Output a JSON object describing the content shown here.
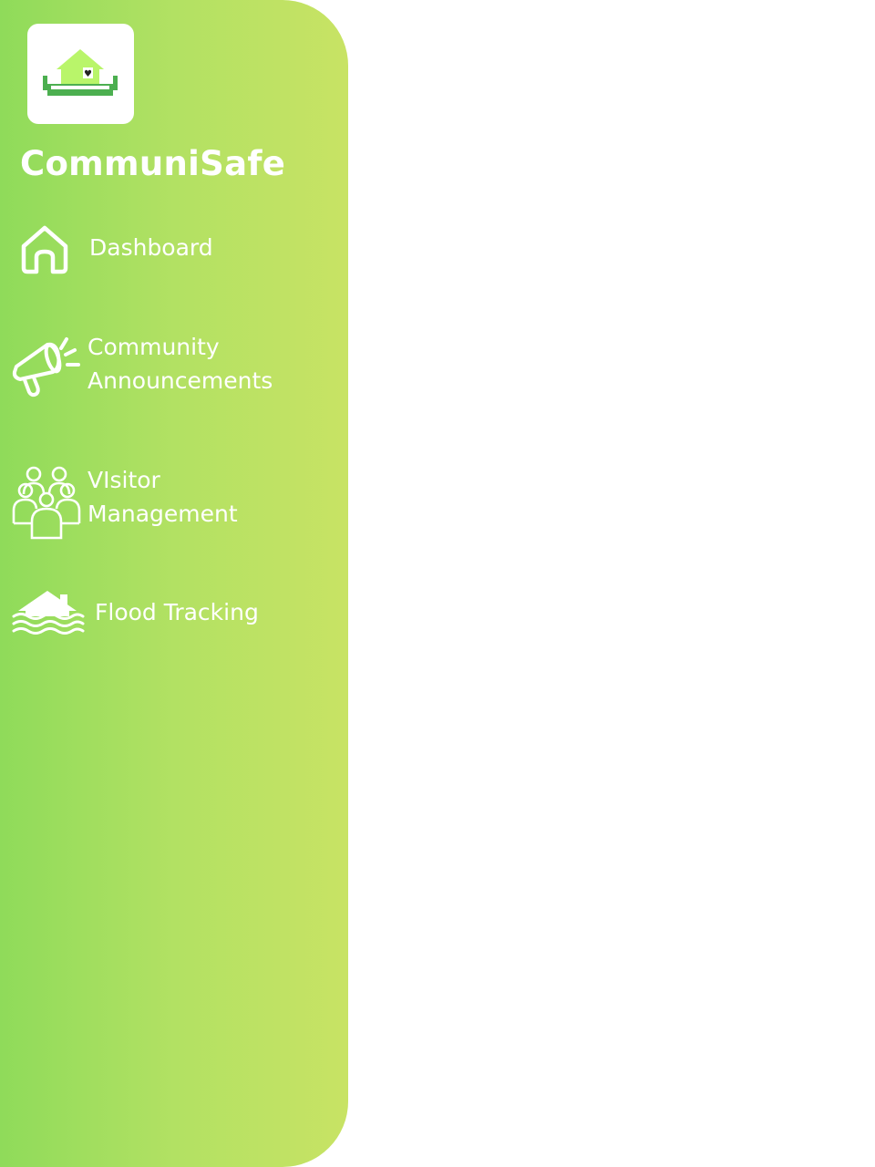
{
  "app": {
    "title": "CommuniSafe",
    "logo_icon": "home-shelter-logo-icon"
  },
  "colors": {
    "sidebar_gradient_start": "#8fdb5a",
    "sidebar_gradient_end": "#c8e364",
    "text": "#ffffff",
    "background": "#ffffff",
    "logo_green": "#4caf50",
    "logo_light_green": "#b9f56a"
  },
  "sidebar": {
    "items": [
      {
        "icon": "home-icon",
        "label": "Dashboard",
        "lines": [
          "Dashboard"
        ]
      },
      {
        "icon": "megaphone-icon",
        "label": "Community Announcements",
        "lines": [
          "Community",
          "Announcements"
        ]
      },
      {
        "icon": "people-group-icon",
        "label": "VIsitor Management",
        "lines": [
          "VIsitor",
          "Management"
        ]
      },
      {
        "icon": "flooded-house-icon",
        "label": "Flood Tracking",
        "lines": [
          "Flood Tracking"
        ]
      }
    ]
  }
}
